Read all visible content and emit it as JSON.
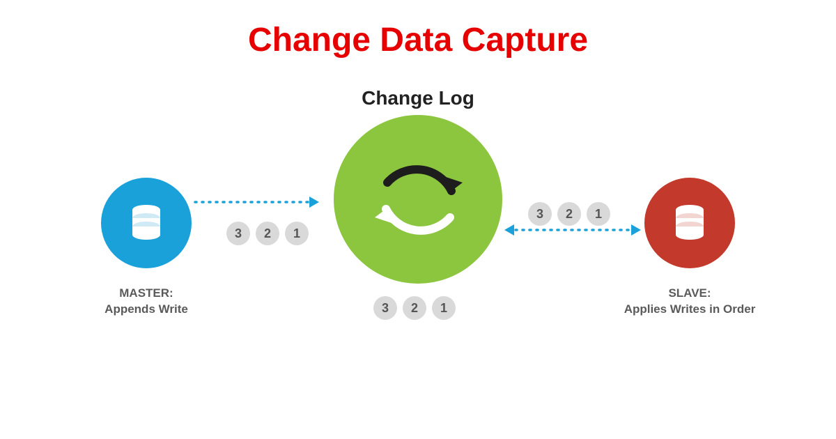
{
  "title": "Change Data Capture",
  "center": {
    "heading": "Change Log"
  },
  "master": {
    "label_line1": "MASTER:",
    "label_line2": "Appends Write"
  },
  "slave": {
    "label_line1": "SLAVE:",
    "label_line2": "Applies Writes in Order"
  },
  "sequence_left": [
    "3",
    "2",
    "1"
  ],
  "sequence_right": [
    "3",
    "2",
    "1"
  ],
  "sequence_center": [
    "3",
    "2",
    "1"
  ],
  "colors": {
    "title": "#e60000",
    "master_bg": "#1ba1da",
    "center_bg": "#8cc63f",
    "slave_bg": "#c3392c",
    "arrow": "#1ba1da",
    "pill_bg": "#d9d9d9"
  }
}
